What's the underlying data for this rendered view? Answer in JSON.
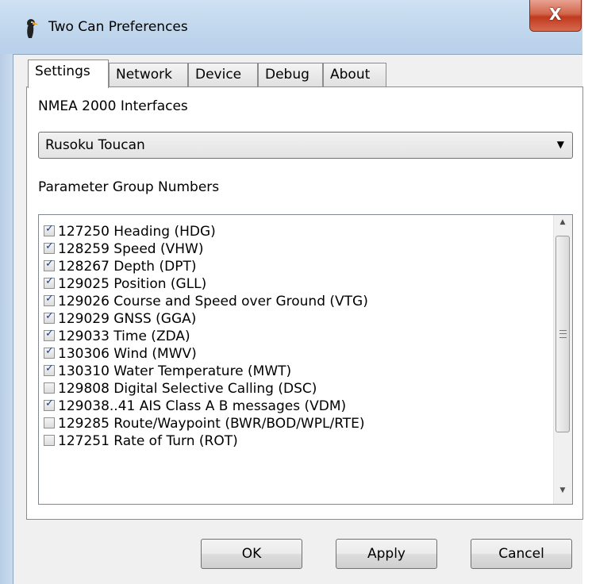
{
  "window": {
    "title": "Two Can Preferences",
    "close_label": "X"
  },
  "tabs": [
    {
      "label": "Settings",
      "active": true
    },
    {
      "label": "Network",
      "active": false
    },
    {
      "label": "Device",
      "active": false
    },
    {
      "label": "Debug",
      "active": false
    },
    {
      "label": "About",
      "active": false
    }
  ],
  "settings": {
    "interfaces_label": "NMEA 2000 Interfaces",
    "interface_selected": "Rusoku Toucan",
    "pgn_label": "Parameter Group Numbers",
    "pgns": [
      {
        "label": "127250 Heading (HDG)",
        "checked": true
      },
      {
        "label": "128259 Speed (VHW)",
        "checked": true
      },
      {
        "label": "128267 Depth (DPT)",
        "checked": true
      },
      {
        "label": "129025 Position (GLL)",
        "checked": true
      },
      {
        "label": "129026 Course and Speed over Ground (VTG)",
        "checked": true
      },
      {
        "label": "129029 GNSS (GGA)",
        "checked": true
      },
      {
        "label": "129033 Time (ZDA)",
        "checked": true
      },
      {
        "label": "130306 Wind (MWV)",
        "checked": true
      },
      {
        "label": "130310 Water Temperature (MWT)",
        "checked": true
      },
      {
        "label": "129808 Digital Selective Calling (DSC)",
        "checked": false
      },
      {
        "label": "129038..41 AIS Class A  B messages (VDM)",
        "checked": true
      },
      {
        "label": "129285 Route/Waypoint (BWR/BOD/WPL/RTE)",
        "checked": false
      },
      {
        "label": "127251 Rate of Turn (ROT)",
        "checked": false
      }
    ]
  },
  "buttons": {
    "ok": "OK",
    "apply": "Apply",
    "cancel": "Cancel"
  }
}
